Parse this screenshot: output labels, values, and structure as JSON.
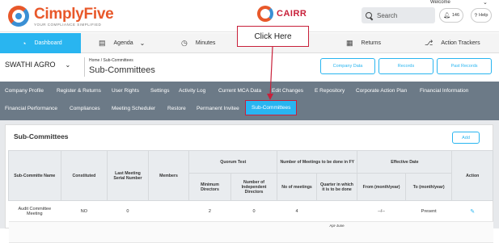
{
  "header": {
    "logo_name": "CimplyFive",
    "logo_tagline": "YOUR COMPLIANCE SIMPLIFIED",
    "product_logo": "CAIRR",
    "search_placeholder": "Search",
    "welcome": "Welcome",
    "notification_count": "146",
    "help_label": "Help"
  },
  "main_nav": [
    {
      "label": "Dashboard",
      "icon": "dashboard-icon",
      "active": true
    },
    {
      "label": "Agenda",
      "icon": "list-icon",
      "active": false
    },
    {
      "label": "Minutes",
      "icon": "clock-icon",
      "active": false
    },
    {
      "label": "Returns",
      "icon": "document-icon",
      "active": false
    },
    {
      "label": "Action Trackers",
      "icon": "tracker-icon",
      "active": false
    }
  ],
  "company_bar": {
    "company_name": "SWATHI AGRO",
    "breadcrumb": "Home  /  Sub-Committees",
    "page_title": "Sub-Committees",
    "buttons": [
      "Company Data",
      "Records",
      "Past Records"
    ]
  },
  "sub_nav": {
    "row1": [
      "Company Profile",
      "Register & Returns",
      "User Rights",
      "Settings",
      "Activity Log",
      "Current MCA Data",
      "Edit Changes",
      "E Repository",
      "Corporate Action Plan",
      "Financial Information"
    ],
    "row2": [
      "Financial Performance",
      "Compliances",
      "Meeting Scheduler",
      "Restore",
      "Permanent Invitee",
      "Sub-Committees"
    ]
  },
  "panel": {
    "title": "Sub-Committees",
    "add_label": "Add"
  },
  "table": {
    "headers": {
      "name": "Sub-Committe Name",
      "constituted": "Constituted",
      "last_meeting": "Last Meeting Serial Number",
      "members": "Members",
      "quorum": "Quorum Test",
      "meetings_fy": "Number of Meetings to be done in FY",
      "effective": "Effective Date",
      "action": "Action",
      "min_directors": "Minimum Directors",
      "independent": "Number of Independent Directors",
      "no_meetings": "No of meetings",
      "quarter": "Quarter in which it is to be done",
      "from": "From (month/year)",
      "to": "To (month/year)"
    },
    "rows": [
      {
        "name": "Audit Committee Meeting",
        "constituted": "NO",
        "last_meeting": "0",
        "members": "",
        "min_directors": "2",
        "independent": "0",
        "no_meetings": "4",
        "quarter": "",
        "from": "--/--",
        "to": "Present"
      }
    ],
    "partial_row_text": "Apr-June"
  },
  "annotation": {
    "callout": "Click Here"
  },
  "colors": {
    "accent": "#29b5f0",
    "subnav_bg": "#6c7a87",
    "callout_border": "#c8203a",
    "brand_orange": "#e8582a"
  }
}
